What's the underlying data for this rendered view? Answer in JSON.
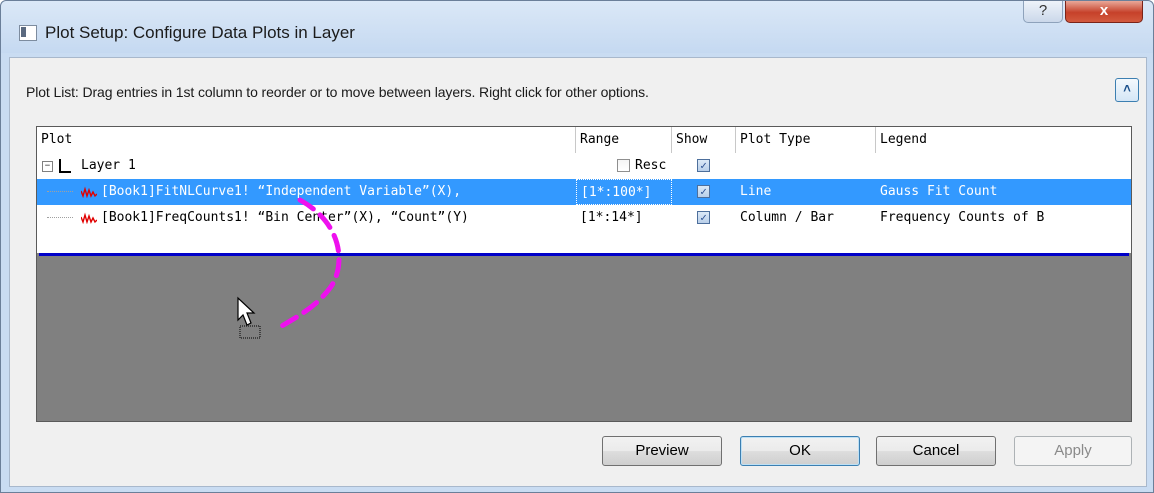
{
  "window": {
    "title": "Plot Setup: Configure Data Plots in Layer",
    "help_glyph": "?",
    "close_glyph": "x"
  },
  "hint_text": "Plot List: Drag entries in 1st column to reorder or to move between layers. Right click for other options.",
  "collapse_glyph": "˄",
  "grid": {
    "columns": [
      "Plot",
      "Range",
      "Show",
      "Plot Type",
      "Legend"
    ],
    "layer_row": {
      "expander": "−",
      "label": "Layer 1",
      "rescale_label": "Resc",
      "rescale_checked": false,
      "show_checked": true
    },
    "plot_rows": [
      {
        "plot": "[Book1]FitNLCurve1! “Independent Variable”(X),",
        "range": "[1*:100*]",
        "show": true,
        "plot_type": "Line",
        "legend": "Gauss Fit Count",
        "selected": true
      },
      {
        "plot": "[Book1]FreqCounts1! “Bin Center”(X), “Count”(Y)",
        "range": "[1*:14*]",
        "show": true,
        "plot_type": "Column / Bar",
        "legend": "Frequency Counts of B",
        "selected": false
      }
    ]
  },
  "check_glyph": "✓",
  "buttons": {
    "preview": "Preview",
    "ok": "OK",
    "cancel": "Cancel",
    "apply": "Apply"
  },
  "colors": {
    "selection": "#3399ff",
    "grid_background": "#808080",
    "drag_arrow": "#ee10ee",
    "insert_line": "#0000c8"
  }
}
